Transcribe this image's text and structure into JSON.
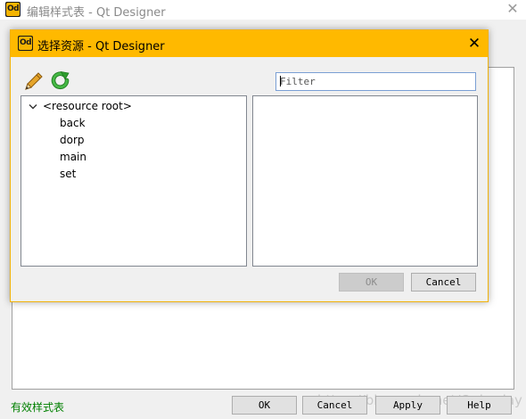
{
  "background_window": {
    "title": "编辑样式表 - Qt Designer",
    "close_glyph": "✕",
    "status_text": "有效样式表",
    "buttons": {
      "ok": "OK",
      "cancel": "Cancel",
      "apply": "Apply",
      "help": "Help"
    },
    "watermark": "https://blog.csdn.net/Only_day"
  },
  "dialog": {
    "title": "选择资源 - Qt Designer",
    "close_glyph": "✕",
    "toolbar": {
      "edit_icon": "pencil-icon",
      "reload_icon": "refresh-icon"
    },
    "filter": {
      "placeholder": "Filter",
      "value": ""
    },
    "tree": {
      "root": "<resource root>",
      "children": [
        "back",
        "dorp",
        "main",
        "set"
      ]
    },
    "buttons": {
      "ok": "OK",
      "cancel": "Cancel"
    }
  },
  "colors": {
    "dialog_title_bar": "#ffb900",
    "app_icon": "#f5b400",
    "status_valid": "#008000",
    "refresh_icon": "#2e9d2e"
  },
  "app_icon_text": "Od"
}
